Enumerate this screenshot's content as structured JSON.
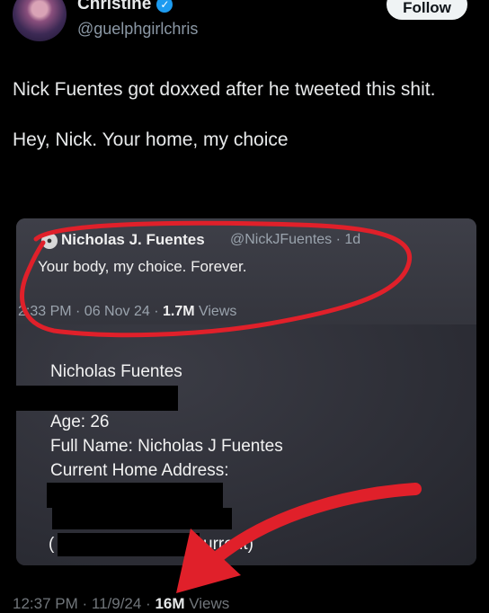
{
  "author": {
    "name": "Christine",
    "handle": "@guelphgirlchris",
    "follow_label": "Follow",
    "verified_icon": "verified-badge-icon"
  },
  "tweet": {
    "paragraphs": [
      "Nick Fuentes got doxxed after he tweeted this shit.",
      "Hey, Nick. Your home, my choice"
    ]
  },
  "quoted_tweet": {
    "name": "Nicholas J. Fuentes",
    "handle": "@NickJFuentes · 1d",
    "text": "Your body, my choice. Forever.",
    "time": "2:33 PM · 06 Nov 24 · ",
    "views_count": "1.7M",
    "views_label": " Views"
  },
  "dox_info": {
    "name": "Nicholas Fuentes",
    "age": "Age: 26",
    "full_name": "Full Name: Nicholas J Fuentes",
    "address_label": "Current Home Address:",
    "current_left": "(",
    "current_right": "urrent)"
  },
  "footer": {
    "time": "12:37 PM · 11/9/24 · ",
    "views_count": "16M",
    "views_label": " Views"
  },
  "colors": {
    "background": "#000000",
    "accent_blue": "#1d9bf0",
    "annotation_red": "#e0202a"
  }
}
